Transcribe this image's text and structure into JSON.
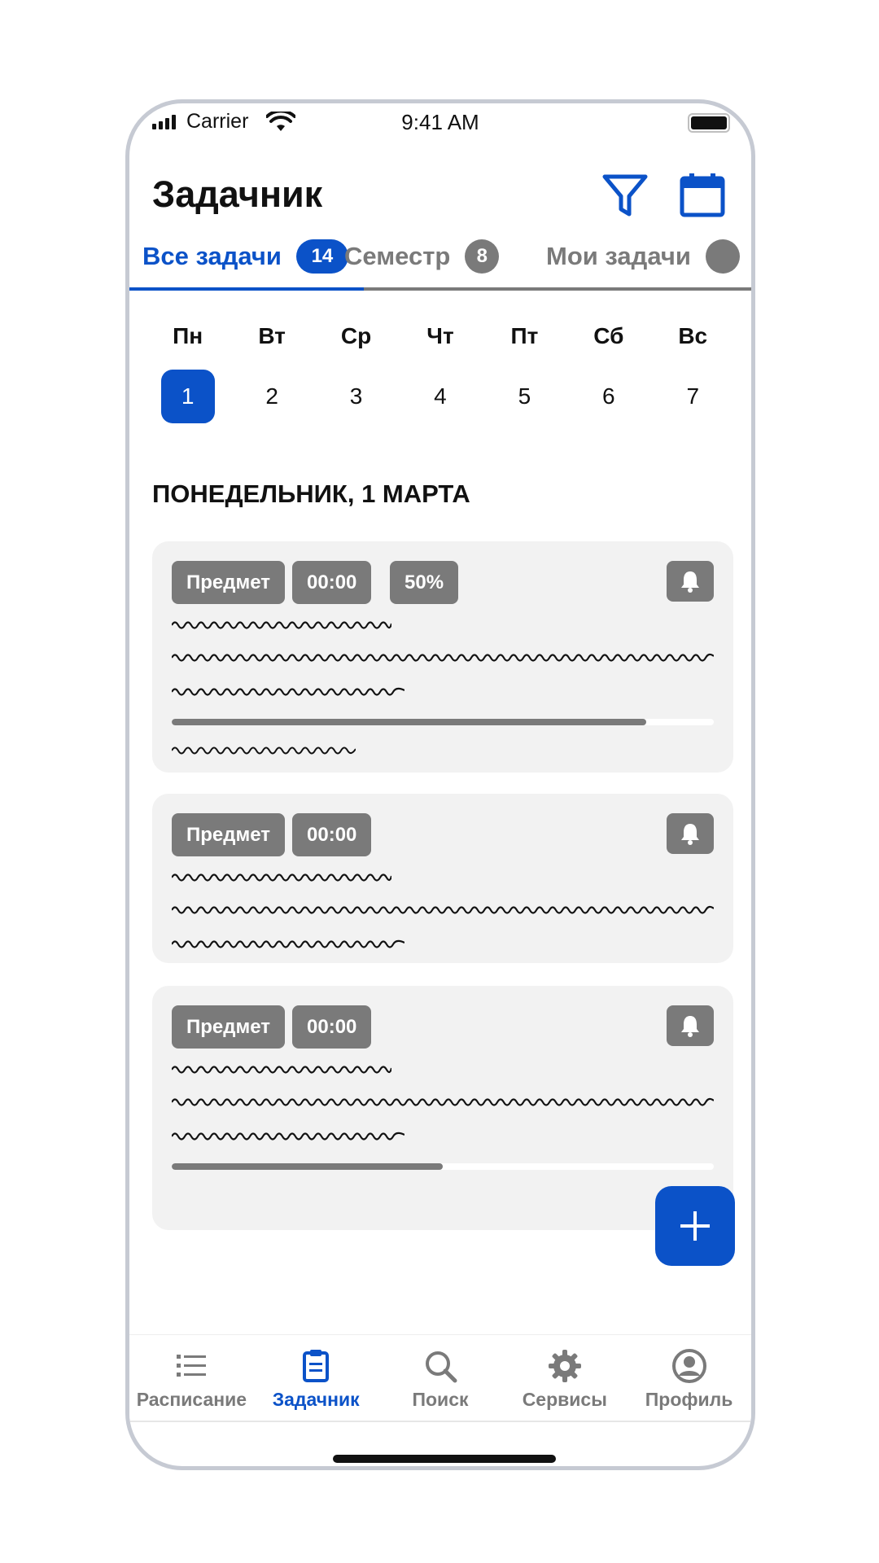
{
  "status": {
    "carrier": "Carrier",
    "time": "9:41 AM"
  },
  "header": {
    "title": "Задачник",
    "icons": [
      "filter-icon",
      "calendar-icon"
    ]
  },
  "tabs": [
    {
      "label": "Все задачи",
      "count": "14",
      "active": true
    },
    {
      "label": "Семестр",
      "count": "8",
      "active": false
    },
    {
      "label": "Мои задачи",
      "count": "",
      "active": false
    }
  ],
  "week": {
    "days": [
      "Пн",
      "Вт",
      "Ср",
      "Чт",
      "Пт",
      "Сб",
      "Вс"
    ],
    "dates": [
      "1",
      "2",
      "3",
      "4",
      "5",
      "6",
      "7"
    ],
    "selected": "1"
  },
  "date_heading": "ПОНЕДЕЛЬНИК, 1 МАРТА",
  "cards": [
    {
      "subject": "Предмет",
      "time": "00:00",
      "percent": "50%",
      "progress": 0.875
    },
    {
      "subject": "Предмет",
      "time": "00:00"
    },
    {
      "subject": "Предмет",
      "time": "00:00",
      "progress": 0.5
    }
  ],
  "nav": {
    "items": [
      {
        "label": "Расписание",
        "icon": "list-icon"
      },
      {
        "label": "Задачник",
        "icon": "clipboard-icon",
        "active": true
      },
      {
        "label": "Поиск",
        "icon": "search-icon"
      },
      {
        "label": "Сервисы",
        "icon": "gear-icon"
      },
      {
        "label": "Профиль",
        "icon": "profile-icon"
      }
    ]
  },
  "colors": {
    "accent": "#0b52c8",
    "chip": "#7a7a7a",
    "card": "#f2f2f2"
  }
}
